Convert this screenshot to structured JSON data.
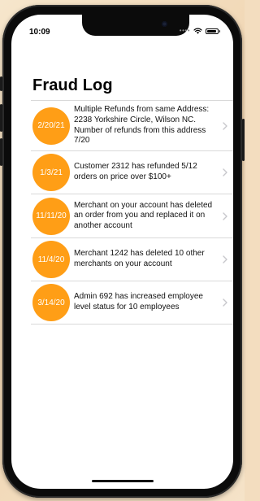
{
  "status_bar": {
    "time": "10:09",
    "signal_icon": "signal-dots-icon",
    "wifi_icon": "wifi-icon",
    "battery_icon": "battery-icon",
    "battery_level": 0.9
  },
  "page": {
    "title": "Fraud Log"
  },
  "colors": {
    "accent": "#ff9e16",
    "separator": "#d9d9d9",
    "chevron": "#c7c7cc"
  },
  "fraud_log": {
    "items": [
      {
        "date": "2/20/21",
        "text": "Multiple Refunds from same Address: 2238 Yorkshire Circle, Wilson NC. Number of refunds from this address 7/20"
      },
      {
        "date": "1/3/21",
        "text": "Customer 2312 has refunded 5/12 orders on price over $100+"
      },
      {
        "date": "11/11/20",
        "text": "Merchant on your account has deleted an order from you and replaced it on another account"
      },
      {
        "date": "11/4/20",
        "text": "Merchant 1242 has deleted 10 other merchants on your account"
      },
      {
        "date": "3/14/20",
        "text": "Admin 692 has increased employee level status for 10 employees"
      }
    ]
  }
}
